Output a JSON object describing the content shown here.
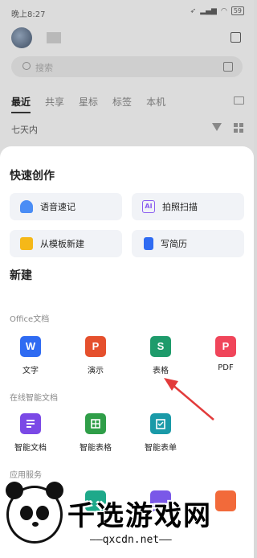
{
  "status_bar": {
    "time": "晚上8:27",
    "battery": "59"
  },
  "search": {
    "placeholder": "搜索"
  },
  "tabs": [
    {
      "label": "最近",
      "active": true
    },
    {
      "label": "共享"
    },
    {
      "label": "星标"
    },
    {
      "label": "标签"
    },
    {
      "label": "本机"
    }
  ],
  "filter": {
    "label": "七天内"
  },
  "sheet": {
    "quick_title": "快速创作",
    "quick_items": [
      {
        "label": "语音速记",
        "icon": "voice-note-icon"
      },
      {
        "label": "拍照扫描",
        "icon": "ai-scan-icon"
      },
      {
        "label": "从模板新建",
        "icon": "template-icon"
      },
      {
        "label": "写简历",
        "icon": "resume-icon"
      }
    ],
    "new_title": "新建",
    "office_label": "Office文档",
    "office_items": [
      {
        "label": "文字",
        "glyph": "W",
        "color": "#2f6bf2"
      },
      {
        "label": "演示",
        "glyph": "P",
        "color": "#e5502d"
      },
      {
        "label": "表格",
        "glyph": "S",
        "color": "#1e9b6b"
      },
      {
        "label": "PDF",
        "glyph": "P",
        "color": "#f0455a"
      }
    ],
    "online_label": "在线智能文档",
    "online_items": [
      {
        "label": "智能文档",
        "color": "#7b49e6"
      },
      {
        "label": "智能表格",
        "color": "#2f9e48"
      },
      {
        "label": "智能表单",
        "color": "#1a9aa8"
      }
    ],
    "app_label": "应用服务"
  },
  "watermark": {
    "title": "千选游戏网",
    "url": "——qxcdn.net——"
  }
}
